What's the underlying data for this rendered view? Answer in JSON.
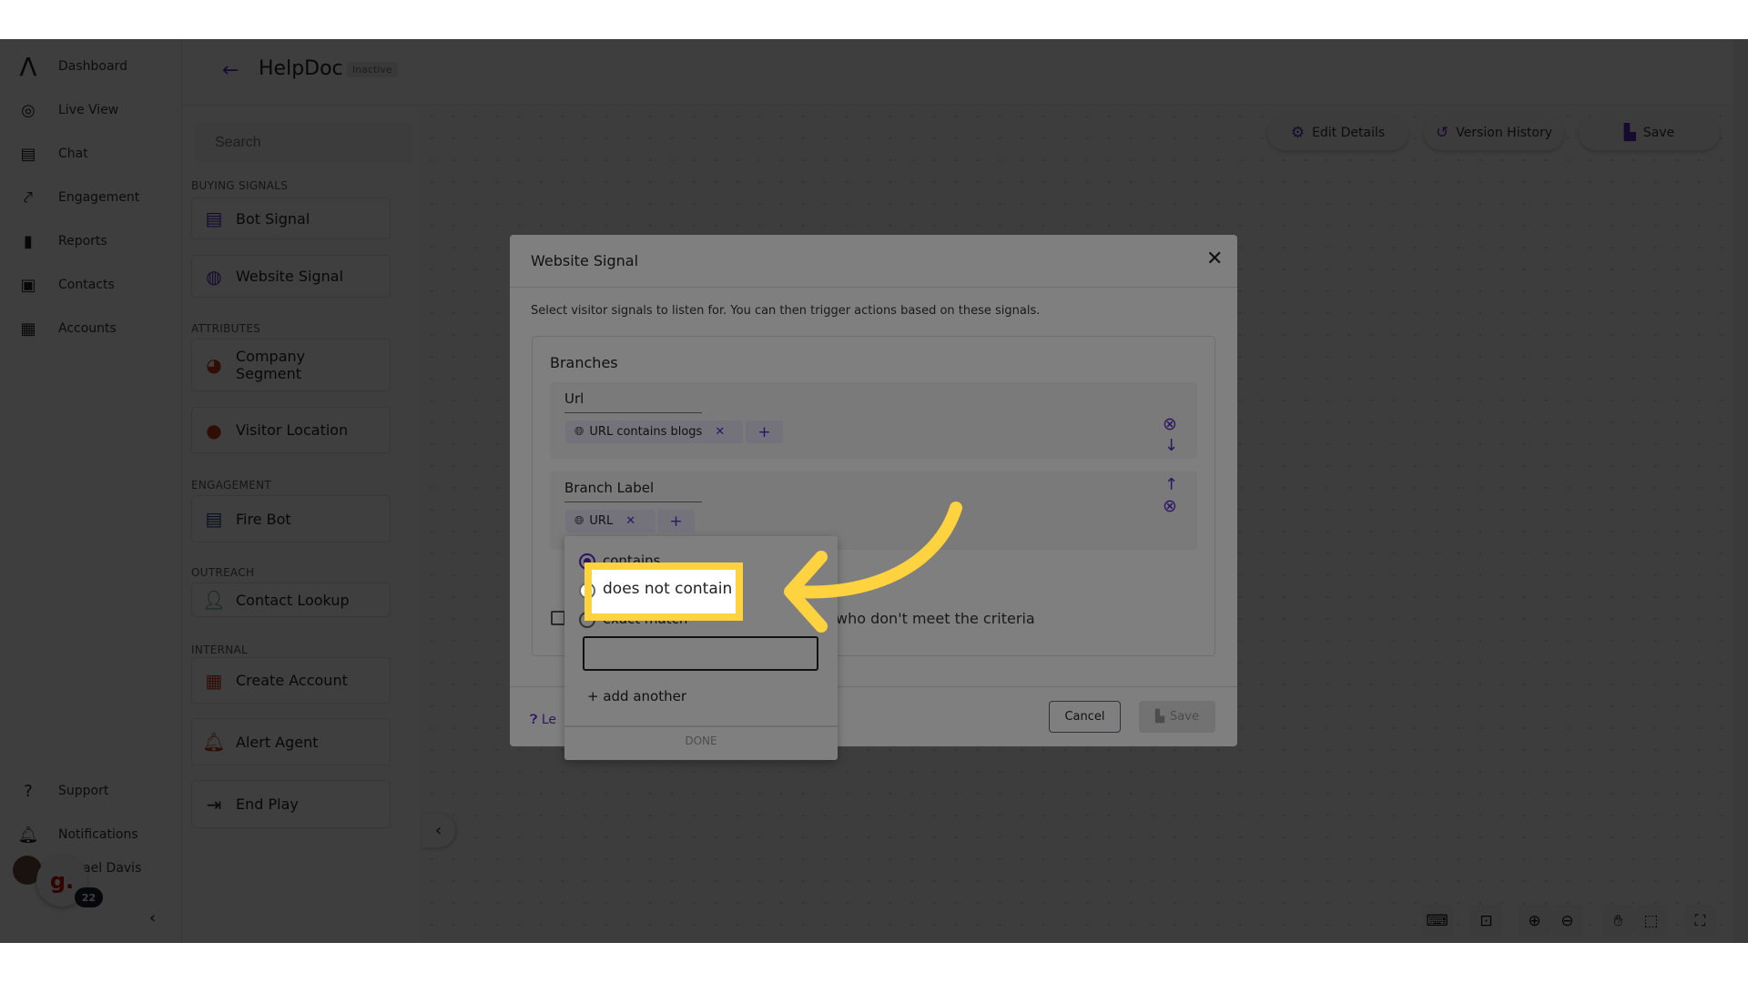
{
  "nav": {
    "items": [
      {
        "label": "Dashboard",
        "icon": "logo-icon"
      },
      {
        "label": "Live View",
        "icon": "live-view-icon"
      },
      {
        "label": "Chat",
        "icon": "chat-icon"
      },
      {
        "label": "Engagement",
        "icon": "engagement-icon"
      },
      {
        "label": "Reports",
        "icon": "bar-chart-icon"
      },
      {
        "label": "Contacts",
        "icon": "contacts-icon"
      },
      {
        "label": "Accounts",
        "icon": "building-icon"
      }
    ],
    "support": "Support",
    "notifications": "Notifications",
    "user_name": "ael Davis",
    "badge_count": "22",
    "widget_letter": "g."
  },
  "header": {
    "title": "HelpDoc",
    "status": "Inactive"
  },
  "panel": {
    "search_placeholder": "Search",
    "sections": {
      "buying": "BUYING SIGNALS",
      "attributes": "ATTRIBUTES",
      "engagement": "ENGAGEMENT",
      "outreach": "OUTREACH",
      "internal": "INTERNAL"
    },
    "cards": {
      "bot_signal": "Bot Signal",
      "website_signal": "Website Signal",
      "company_segment": "Company Segment",
      "visitor_location": "Visitor Location",
      "fire_bot": "Fire Bot",
      "contact_lookup": "Contact Lookup",
      "create_account": "Create Account",
      "alert_agent": "Alert Agent",
      "end_play": "End Play"
    }
  },
  "toolbar": {
    "edit_details": "Edit Details",
    "version_history": "Version History",
    "save": "Save"
  },
  "modal": {
    "title": "Website Signal",
    "description": "Select visitor signals to listen for. You can then trigger actions based on these signals.",
    "branches_title": "Branches",
    "branches": [
      {
        "label": "Url",
        "chip": "URL contains blogs"
      },
      {
        "label": "Branch Label",
        "chip": "URL"
      }
    ],
    "criteria_text": "who don't meet the criteria",
    "learn_partial": "Le",
    "cancel": "Cancel",
    "save": "Save"
  },
  "popup": {
    "options": [
      "contains",
      "does not contain",
      "exact match"
    ],
    "selected": "contains",
    "input_value": "",
    "add_another": "+ add another",
    "done": "DONE"
  },
  "annotation": {
    "highlight_text": "does not contain",
    "color": "#ffd23f"
  },
  "colors": {
    "accent": "#5b2bc7",
    "highlight": "#ffd23f"
  }
}
